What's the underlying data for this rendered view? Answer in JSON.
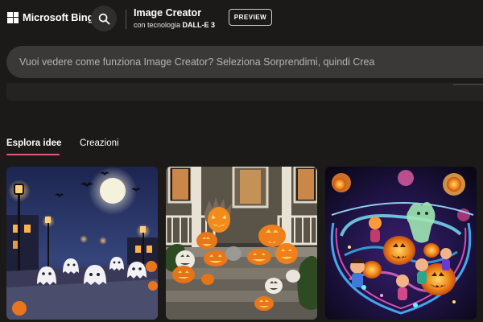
{
  "header": {
    "brand": "Microsoft Bing",
    "app_title": "Image Creator",
    "app_subtitle_prefix": "con tecnologia ",
    "app_subtitle_model": "DALL-E 3",
    "preview_label": "PREVIEW"
  },
  "prompt": {
    "placeholder": "Vuoi vedere come funziona Image Creator? Seleziona Sorprendimi, quindi Crea",
    "value": ""
  },
  "tabs": [
    {
      "label": "Esplora idee",
      "active": true
    },
    {
      "label": "Creazioni",
      "active": false
    }
  ],
  "colors": {
    "background": "#1b1a19",
    "tab_accent": "#e25a7a",
    "prompt_background": "#3a3937"
  },
  "icons": {
    "brand": "microsoft-logo-icon",
    "search": "search-icon"
  }
}
